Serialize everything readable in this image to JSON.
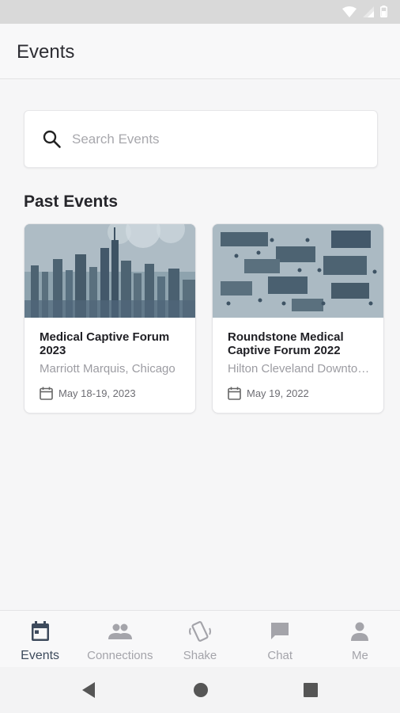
{
  "app": {
    "title": "Events"
  },
  "search": {
    "placeholder": "Search Events",
    "value": ""
  },
  "section": {
    "title": "Past Events"
  },
  "events": [
    {
      "title": "Medical Captive Forum 2023",
      "location": "Marriott Marquis, Chicago",
      "date": "May 18-19, 2023",
      "image": "city-skyline-photo"
    },
    {
      "title": "Roundstone Medical Captive Forum 2022",
      "location": "Hilton Cleveland Downtown",
      "date": "May 19, 2022",
      "image": "conference-hall-photo"
    }
  ],
  "bottom_nav": [
    {
      "label": "Events",
      "icon": "calendar-icon",
      "active": true
    },
    {
      "label": "Connections",
      "icon": "people-icon",
      "active": false
    },
    {
      "label": "Shake",
      "icon": "shake-phone-icon",
      "active": false
    },
    {
      "label": "Chat",
      "icon": "chat-icon",
      "active": false
    },
    {
      "label": "Me",
      "icon": "person-icon",
      "active": false
    }
  ],
  "colors": {
    "accent": "#3d4a5c",
    "inactive": "#a4a4aa",
    "photo_tint": "#4e6374"
  }
}
